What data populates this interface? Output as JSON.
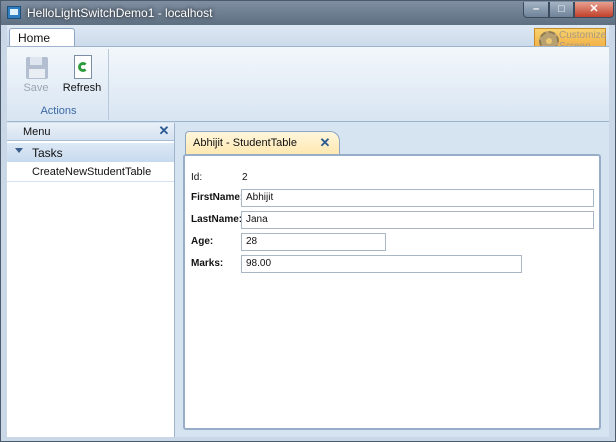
{
  "window": {
    "title": "HelloLightSwitchDemo1 - localhost",
    "minimize_glyph": "–",
    "maximize_glyph": "□",
    "close_glyph": "✕"
  },
  "ribbon": {
    "tabs": [
      {
        "label": "Home"
      }
    ],
    "customize_label": "Customize Screen",
    "groups": [
      {
        "label": "Actions",
        "buttons": [
          {
            "label": "Save",
            "icon": "floppy-disk-icon",
            "enabled": false
          },
          {
            "label": "Refresh",
            "icon": "refresh-icon",
            "enabled": true
          }
        ]
      }
    ]
  },
  "nav": {
    "title": "Menu",
    "close_glyph": "✕",
    "sections": [
      {
        "label": "Tasks",
        "items": [
          {
            "label": "CreateNewStudentTable"
          }
        ]
      }
    ]
  },
  "document": {
    "tab_title": "Abhijit - StudentTable",
    "tab_close_glyph": "✕",
    "fields": [
      {
        "label": "Id:",
        "value": "2",
        "editable": false
      },
      {
        "label": "FirstName:",
        "value": "Abhijit",
        "editable": true
      },
      {
        "label": "LastName:",
        "value": "Jana",
        "editable": true
      },
      {
        "label": "Age:",
        "value": "28",
        "editable": true
      },
      {
        "label": "Marks:",
        "value": "98.00",
        "editable": true
      }
    ]
  },
  "colors": {
    "accent": "#3b69a3",
    "tab_active": "#ffe8b0",
    "close_button": "#c0402a"
  }
}
